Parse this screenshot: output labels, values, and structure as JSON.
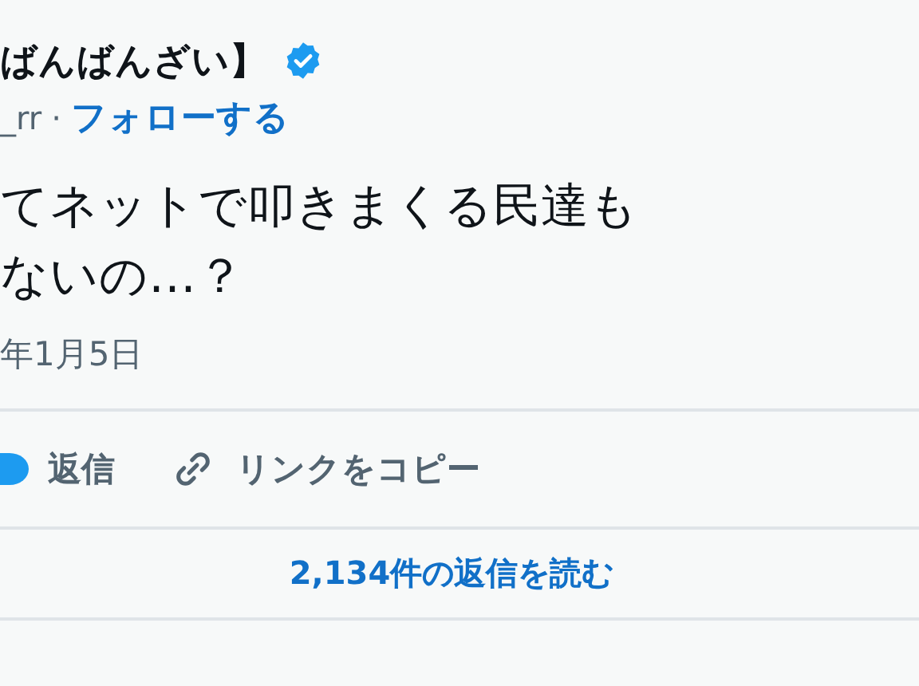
{
  "author": {
    "name": "ばんばんざい】",
    "verified": true,
    "handle": "_rr",
    "separator": "·",
    "follow": "フォローする"
  },
  "body": [
    "てネットで叩きまくる民達も",
    "ないの…？"
  ],
  "date": "年1月5日",
  "actions": [
    {
      "kind": "reply",
      "label": "返信"
    },
    {
      "kind": "link",
      "label": "リンクをコピー"
    }
  ],
  "read_replies": "2,134件の返信を読む"
}
